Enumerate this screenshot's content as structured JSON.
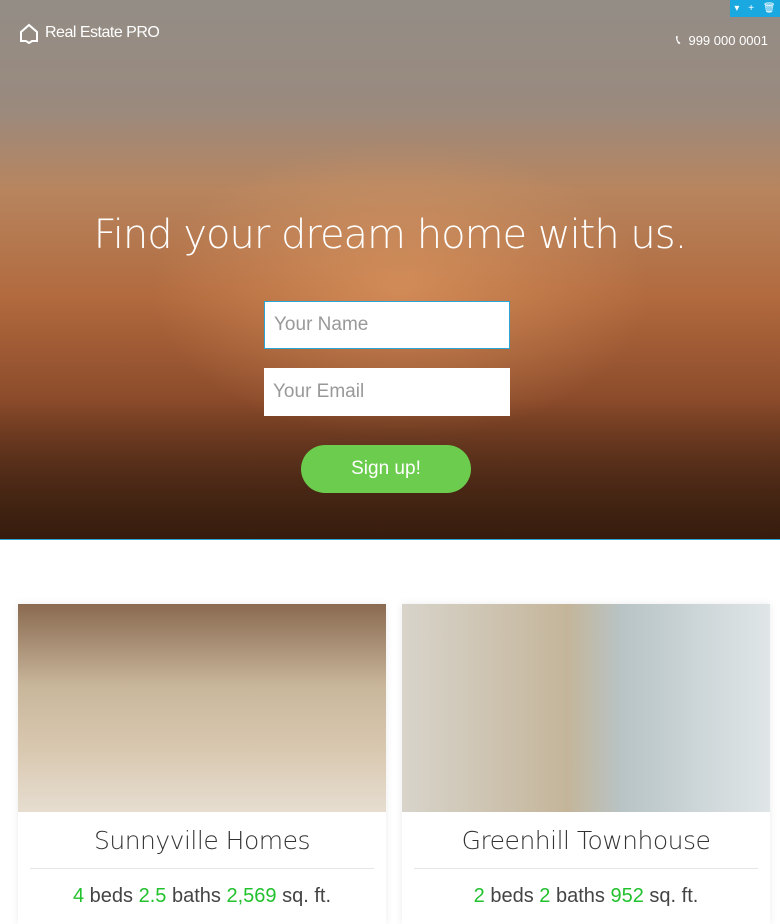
{
  "header": {
    "logo_text": "Real Estate PRO",
    "phone": "999 000 0001"
  },
  "editor_toolbar": {
    "icons": [
      "caret-down-icon",
      "plus-icon",
      "trash-icon"
    ]
  },
  "hero": {
    "headline": "Find your dream home with us.",
    "name_placeholder": "Your Name",
    "email_placeholder": "Your Email",
    "signup_label": "Sign up!"
  },
  "colors": {
    "accent": "#6bcc4e",
    "highlight": "#22c12e",
    "selection": "#2aa6d6"
  },
  "listings": [
    {
      "title": "Sunnyville Homes",
      "beds": "4",
      "baths": "2.5",
      "sqft": "2,569",
      "beds_label": "beds",
      "baths_label": "baths",
      "sqft_label": "sq. ft."
    },
    {
      "title": "Greenhill Townhouse",
      "beds": "2",
      "baths": "2",
      "sqft": "952",
      "beds_label": "beds",
      "baths_label": "baths",
      "sqft_label": "sq. ft."
    }
  ]
}
